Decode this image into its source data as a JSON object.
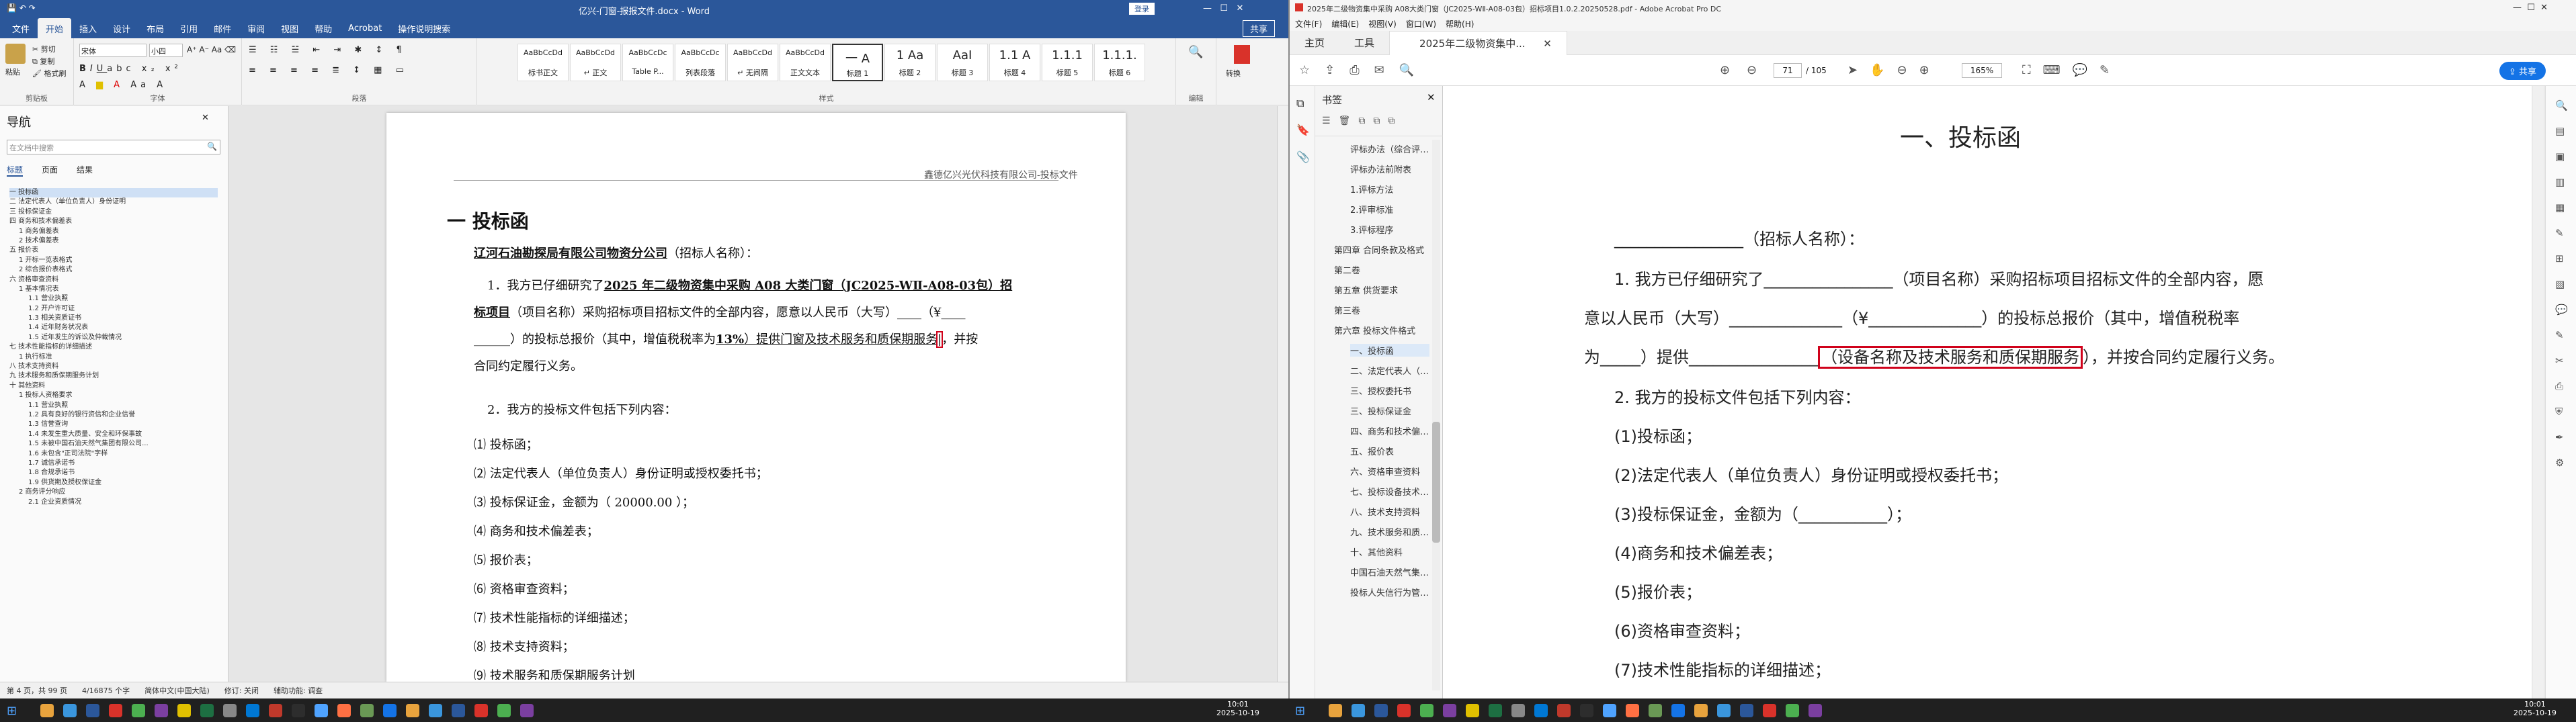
{
  "word": {
    "title": "亿兴-门窗-报报文件.docx - Word",
    "login": "登录",
    "tabs": [
      "文件",
      "开始",
      "插入",
      "设计",
      "布局",
      "引用",
      "邮件",
      "审阅",
      "视图",
      "帮助",
      "Acrobat",
      "操作说明搜索"
    ],
    "share": "共享",
    "ribbon_groups": [
      "剪贴板",
      "字体",
      "段落",
      "样式",
      "编辑"
    ],
    "clipboard": {
      "paste": "粘贴",
      "cut": "剪切",
      "copy": "复制",
      "painter": "格式刷"
    },
    "font": {
      "name": "宋体",
      "size": "小四"
    },
    "styles": [
      {
        "preview": "AaBbCcDd",
        "label": "标书正文"
      },
      {
        "preview": "AaBbCcDd",
        "label": "↵ 正文"
      },
      {
        "preview": "AaBbCcDc",
        "label": "Table P..."
      },
      {
        "preview": "AaBbCcDc",
        "label": "列表段落"
      },
      {
        "preview": "AaBbCcDd",
        "label": "↵ 无间隔"
      },
      {
        "preview": "AaBbCcDd",
        "label": "正文文本"
      },
      {
        "preview": "一 A",
        "label": "标题 1"
      },
      {
        "preview": "1 Aa",
        "label": "标题 2"
      },
      {
        "preview": "AaI",
        "label": "标题 3"
      },
      {
        "preview": "1.1 A",
        "label": "标题 4"
      },
      {
        "preview": "1.1.1",
        "label": "标题 5"
      },
      {
        "preview": "1.1.1.",
        "label": "标题 6"
      }
    ],
    "editing": "编辑",
    "convert": "转换",
    "nav": {
      "title": "导航",
      "search_placeholder": "在文档中搜索",
      "tabs": [
        "标题",
        "页面",
        "结果"
      ],
      "items": [
        "一 投标函",
        "二 法定代表人（单位负责人）身份证明",
        "三 投标保证金",
        "四 商务和技术偏差表",
        "1 商务偏差表",
        "2 技术偏差表",
        "五 报价表",
        "1 开标一览表格式",
        "2 综合报价表格式",
        "六 资格审查资料",
        "1 基本情况表",
        "1.1 营业执照",
        "1.2 开户许可证",
        "1.3 相关资质证书",
        "1.4 近年财务状况表",
        "1.5 近年发生的诉讼及仲裁情况",
        "七 技术性能指标的详细描述",
        "1 执行标准",
        "八 技术支持资料",
        "九 技术服务和质保期服务计划",
        "十 其他资料",
        "1 投标人资格要求",
        "1.1 营业执照",
        "1.2 具有良好的银行资信和企业信誉",
        "1.3 信誉查询",
        "1.4 未发生重大质量、安全和环保事故",
        "1.5 未被中国石油天然气集团有限公司...",
        "1.6 未包含\"正司法院\"字样",
        "1.7 诚信承诺书",
        "1.8 合规承诺书",
        "1.9 供货期及授权保证金",
        "2 商务评分响应",
        "2.1 企业资质情况"
      ]
    },
    "doc": {
      "header": "鑫德亿兴光伏科技有限公司-投标文件",
      "heading": "一 投标函",
      "recipient": "辽河石油勘探局有限公司物资分公司",
      "recipient_suffix": "（招标人名称）：",
      "p1_a": "1．我方已仔细研究了",
      "p1_proj": "2025 年二级物资集中采购 A08 大类门窗（JC2025-WⅡ-A08-03包）招",
      "p1_b": "标项目",
      "p1_c": "（项目名称）采购招标项目招标文件的全部内容，愿意以人民币（大写）____（¥____",
      "p1_d": "______）的投标总报价（其中，增值税税率为",
      "p1_rate": "13%",
      "p1_e": "）提供门窗及技术服务和质保期服务",
      "p1_f": "，并按",
      "p1_g": "合同约定履行义务。",
      "p2": "2．我方的投标文件包括下列内容：",
      "list": [
        "⑴ 投标函；",
        "⑵ 法定代表人（单位负责人）身份证明或授权委托书；",
        "⑶ 投标保证金，金额为（ 20000.00 ）；",
        "⑷ 商务和技术偏差表；",
        "⑸ 报价表；",
        "⑹ 资格审查资料；",
        "⑺ 技术性能指标的详细描述；",
        "⑻ 技术支持资料；",
        "⑼ 技术服务和质保期服务计划"
      ]
    },
    "status": {
      "page": "第 4 页，共 99 页",
      "words": "4/16875 个字",
      "lang": "简体中文(中国大陆)",
      "track": "修订: 关闭",
      "access": "辅助功能: 调查"
    }
  },
  "acrobat": {
    "title": "2025年二级物资集中采购 A08大类门窗（JC2025-WⅡ-A08-03包）招标项目1.0.2.20250528.pdf - Adobe Acrobat Pro DC",
    "menu": [
      "文件(F)",
      "编辑(E)",
      "视图(V)",
      "窗口(W)",
      "帮助(H)"
    ],
    "tabs": [
      "主页",
      "工具",
      "2025年二级物资集中..."
    ],
    "share": "共享",
    "page_current": "71",
    "page_total": "/ 105",
    "zoom": "165%",
    "bookmarks": {
      "title": "书签",
      "items": [
        "评标办法（综合评估法）",
        "评标办法前附表",
        "1.评标方法",
        "2.评审标准",
        "3.评标程序",
        "第四章 合同条款及格式",
        "第二卷",
        "第五章 供货要求",
        "第三卷",
        "第六章 投标文件格式",
        "一、投标函",
        "二、法定代表人（单位负责人）身份证明",
        "三、授权委托书",
        "三、投标保证金",
        "四、商务和技术偏差表",
        "五、报价表",
        "六、资格审查资料",
        "七、投标设备技术性能指标的详细描述",
        "八、技术支持资料",
        "九、技术服务和质保期服务计划",
        "十、其他资料",
        "中国石油天然气集团有限公司",
        "投标人失信行为管理办法"
      ]
    },
    "pdf": {
      "heading": "一、投标函",
      "l1": "________________（招标人名称）：",
      "l2": "1. 我方已仔细研究了________________（项目名称）采购招标项目招标文件的全部内容，愿",
      "l3": "意以人民币（大写）______________（¥______________）的投标总报价（其中，增值税税率",
      "l4a": "为_____）提供________________",
      "l4box": "（设备名称及技术服务和质保期服务",
      "l4b": "），并按合同约定履行义务。",
      "l5": "2. 我方的投标文件包括下列内容：",
      "list": [
        "(1)投标函；",
        "(2)法定代表人（单位负责人）身份证明或授权委托书；",
        "(3)投标保证金，金额为（___________）；",
        "(4)商务和技术偏差表；",
        "(5)报价表；",
        "(6)资格审查资料；",
        "(7)技术性能指标的详细描述；"
      ]
    }
  },
  "taskbar": {
    "left_time": "10:01",
    "left_date": "2025-10-19",
    "right_time": "10:01",
    "right_date": "2025-10-19"
  },
  "colors": {
    "word_blue": "#2b579a",
    "acrobat_blue": "#1473e6",
    "highlight_red": "#d0021b"
  }
}
